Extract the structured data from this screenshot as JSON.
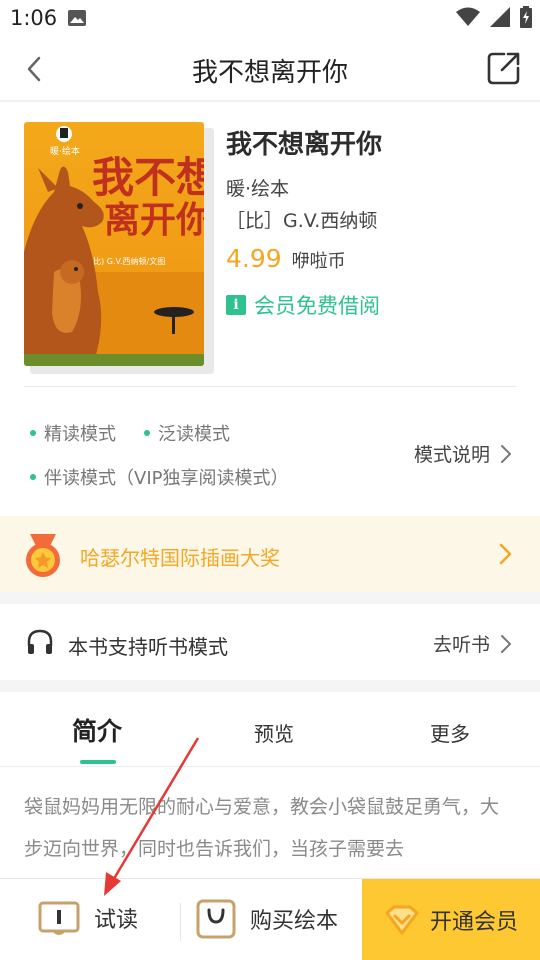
{
  "status_bar": {
    "time": "1:06",
    "icons": [
      "image-icon",
      "wifi-icon",
      "signal-icon",
      "battery-charging-icon"
    ]
  },
  "nav": {
    "title": "我不想离开你",
    "back_icon": "chevron-left-icon",
    "share_icon": "share-icon"
  },
  "book": {
    "cover_title_line1": "我不想",
    "cover_title_line2": "离开你",
    "cover_publisher": "暖·绘本",
    "cover_credit": "(比) G.V.西纳顿/文图",
    "title": "我不想离开你",
    "series": "暖·绘本",
    "author": "［比］G.V.西纳顿",
    "price": "4.99",
    "currency": "咿啦币",
    "member_badge": "i",
    "member_text": "会员免费借阅"
  },
  "modes": {
    "items": [
      "精读模式",
      "泛读模式",
      "伴读模式（VIP独享阅读模式）"
    ],
    "explain_label": "模式说明"
  },
  "award": {
    "text": "哈瑟尔特国际插画大奖"
  },
  "listen": {
    "text": "本书支持听书模式",
    "action": "去听书"
  },
  "tabs": [
    {
      "label": "简介",
      "active": true
    },
    {
      "label": "预览",
      "active": false
    },
    {
      "label": "更多",
      "active": false
    }
  ],
  "intro": {
    "text": "袋鼠妈妈用无限的耐心与爱意，教会小袋鼠鼓足勇气，大步迈向世界，同时也告诉我们，当孩子需要去"
  },
  "bottom": {
    "trial_label": "试读",
    "buy_label": "购买绘本",
    "vip_label": "开通会员"
  },
  "colors": {
    "accent_green": "#2ec28f",
    "price_orange": "#f6a623",
    "vip_yellow": "#fdc832",
    "award_bg": "#fdf7e8",
    "annotation_red": "#e53935"
  }
}
